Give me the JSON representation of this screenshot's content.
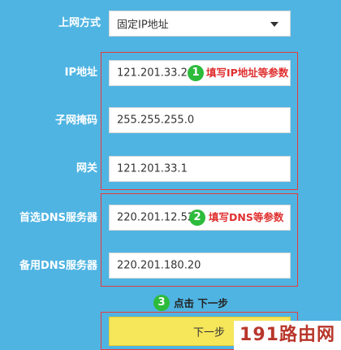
{
  "connection_type": {
    "label": "上网方式",
    "value": "固定IP地址"
  },
  "fields": {
    "ip": {
      "label": "IP地址",
      "value": "121.201.33.20"
    },
    "subnet": {
      "label": "子网掩码",
      "value": "255.255.255.0"
    },
    "gateway": {
      "label": "网关",
      "value": "121.201.33.1"
    },
    "dns1": {
      "label": "首选DNS服务器",
      "value": "220.201.12.52"
    },
    "dns2": {
      "label": "备用DNS服务器",
      "value": "220.201.180.20"
    }
  },
  "annotations": {
    "step1": {
      "number": "1",
      "text": "填写IP地址等参数"
    },
    "step2": {
      "number": "2",
      "text": "填写DNS等参数"
    },
    "step3": {
      "number": "3",
      "text": "点击 下一步"
    }
  },
  "next_button": {
    "label": "下一步"
  },
  "watermark": "191路由网",
  "colors": {
    "background": "#4fb4e2",
    "highlight_border": "#e63c3c",
    "badge": "#2dbb3c",
    "note_text": "#e03030",
    "button": "#f6e65a"
  }
}
